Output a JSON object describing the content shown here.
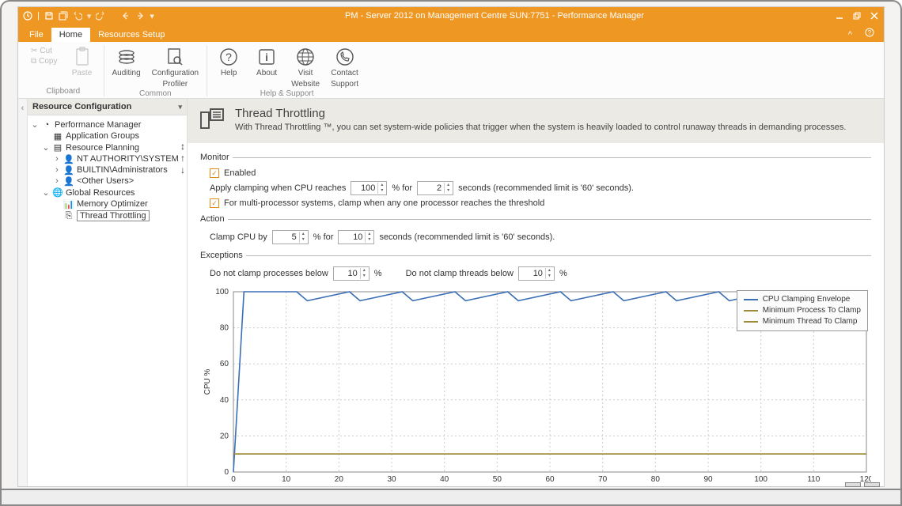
{
  "window": {
    "title": "PM - Server 2012 on Management Centre SUN:7751 - Performance Manager"
  },
  "menu": {
    "file": "File",
    "home": "Home",
    "resources_setup": "Resources Setup"
  },
  "ribbon": {
    "clipboard": {
      "label": "Clipboard",
      "cut": "Cut",
      "copy": "Copy",
      "paste": "Paste"
    },
    "common": {
      "label": "Common",
      "auditing": "Auditing",
      "config_profiler_l1": "Configuration",
      "config_profiler_l2": "Profiler"
    },
    "help": {
      "label": "Help & Support",
      "help": "Help",
      "about": "About",
      "visit_l1": "Visit",
      "visit_l2": "Website",
      "contact_l1": "Contact",
      "contact_l2": "Support"
    }
  },
  "sidebar": {
    "header": "Resource Configuration",
    "root": "Performance Manager",
    "app_groups": "Application Groups",
    "resource_planning": "Resource Planning",
    "nt_sys": "NT AUTHORITY\\SYSTEM",
    "builtin_admin": "BUILTIN\\Administrators",
    "other_users": "<Other Users>",
    "global_resources": "Global Resources",
    "mem_optimizer": "Memory Optimizer",
    "thread_throttling": "Thread Throttling"
  },
  "desc": {
    "title": "Thread Throttling",
    "text": "With Thread Throttling ™, you can set system-wide policies that trigger when the system is heavily loaded to control runaway threads in demanding processes."
  },
  "form": {
    "monitor_legend": "Monitor",
    "enabled_label": "Enabled",
    "apply_pre": "Apply clamping when CPU reaches",
    "apply_mid": "% for",
    "apply_post": "seconds (recommended limit is '60' seconds).",
    "cpu_threshold": "100",
    "cpu_seconds": "2",
    "multi_label": "For multi-processor systems, clamp when any one processor reaches the threshold",
    "action_legend": "Action",
    "clamp_pre": "Clamp CPU by",
    "clamp_mid": "% for",
    "clamp_post": "seconds (recommended limit is '60' seconds).",
    "clamp_pct": "5",
    "clamp_sec": "10",
    "exceptions_legend": "Exceptions",
    "exc_proc_label": "Do not clamp processes below",
    "exc_proc_val": "10",
    "exc_pct1": "%",
    "exc_thr_label": "Do not clamp threads below",
    "exc_thr_val": "10",
    "exc_pct2": "%"
  },
  "chart_data": {
    "type": "line",
    "xlabel": "",
    "ylabel": "CPU %",
    "xlim": [
      0,
      120
    ],
    "ylim": [
      0,
      100
    ],
    "xticks": [
      0,
      10,
      20,
      30,
      40,
      50,
      60,
      70,
      80,
      90,
      100,
      110,
      120
    ],
    "yticks": [
      0,
      20,
      40,
      60,
      80,
      100
    ],
    "series": [
      {
        "name": "CPU Clamping Envelope",
        "color": "#3b6fb6",
        "x": [
          0,
          2,
          12,
          14,
          22,
          24,
          32,
          34,
          42,
          44,
          52,
          54,
          62,
          64,
          72,
          74,
          82,
          84,
          92,
          94,
          102,
          104,
          112,
          114,
          120
        ],
        "y": [
          0,
          100,
          100,
          95,
          100,
          95,
          100,
          95,
          100,
          95,
          100,
          95,
          100,
          95,
          100,
          95,
          100,
          95,
          100,
          95,
          100,
          95,
          100,
          95,
          100
        ]
      },
      {
        "name": "Minimum Process To Clamp",
        "color": "#9c8a3a",
        "x": [
          0,
          120
        ],
        "y": [
          10,
          10
        ]
      },
      {
        "name": "Minimum Thread To Clamp",
        "color": "#9c8a3a",
        "x": [
          0,
          120
        ],
        "y": [
          10,
          10
        ]
      }
    ]
  }
}
